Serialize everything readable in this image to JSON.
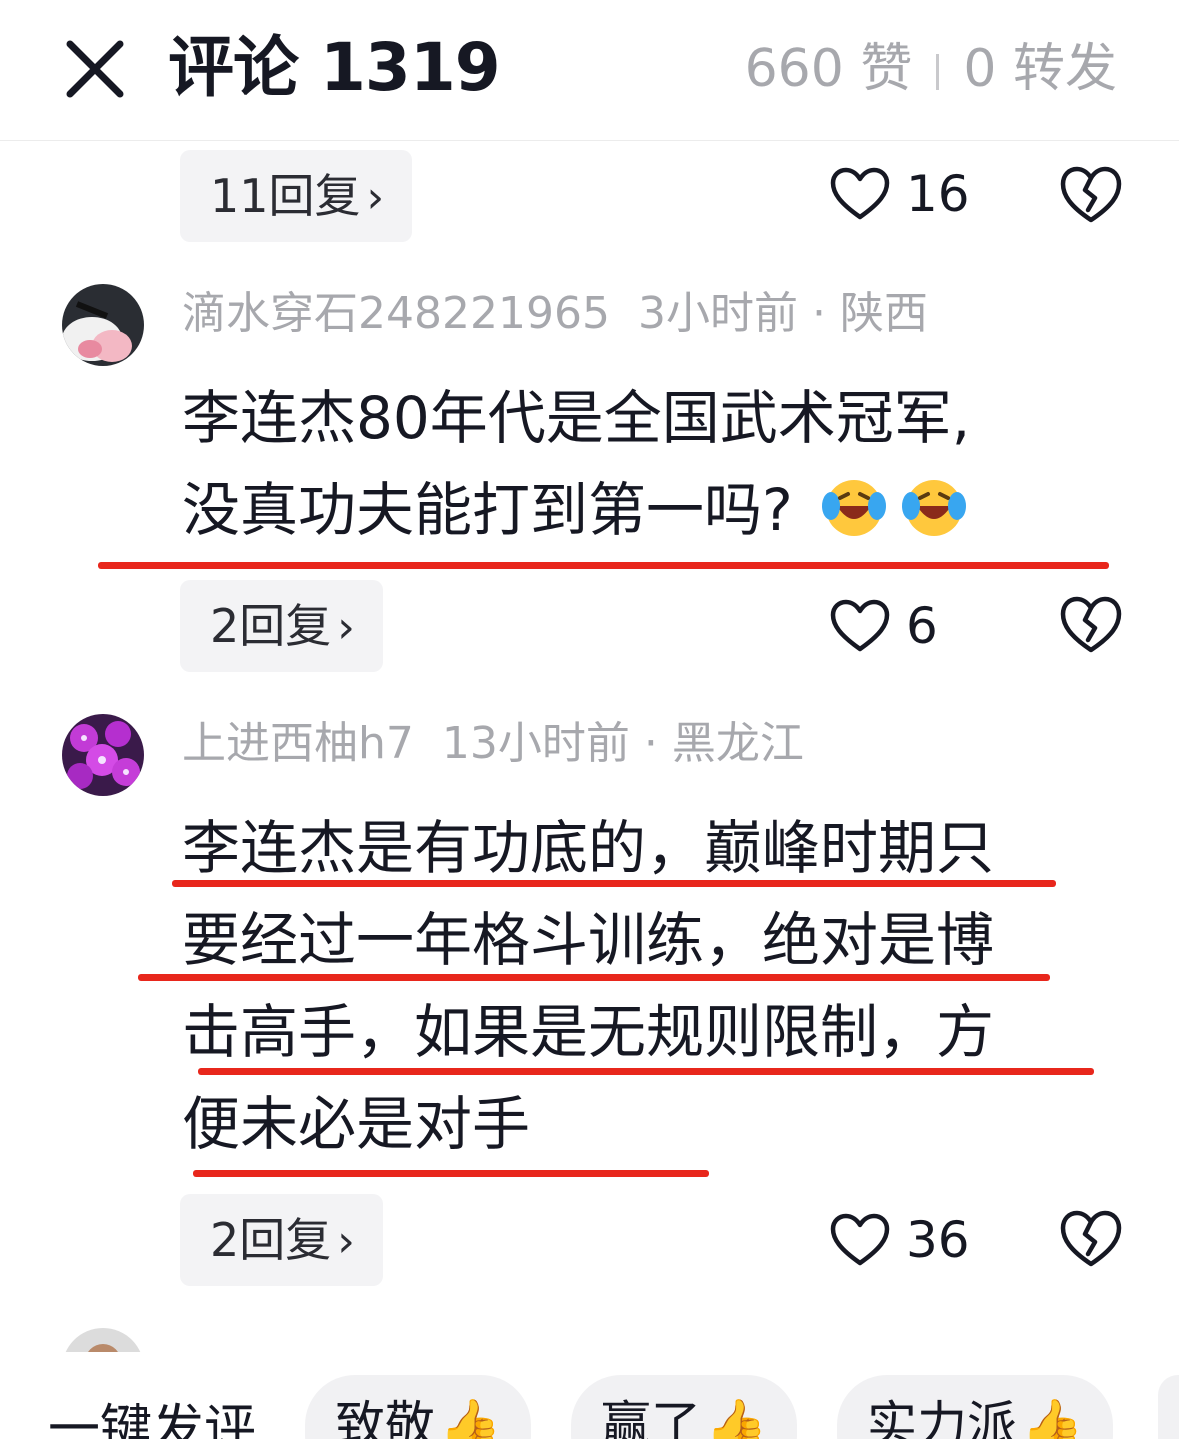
{
  "header": {
    "title": "评论 1319",
    "likes": "660 赞",
    "shares": "0 转发"
  },
  "top_reply": {
    "label": "11回复",
    "likes": "16"
  },
  "comments": [
    {
      "user": "滴水穿石248221965",
      "time": "3小时前",
      "dot": "·",
      "region": "陕西",
      "lines": [
        "李连杰80年代是全国武术冠军,",
        "没真功夫能打到第一吗?"
      ],
      "reply_label": "2回复",
      "likes": "6"
    },
    {
      "user": "上进西柚h7",
      "time": "13小时前",
      "dot": "·",
      "region": "黑龙江",
      "lines": [
        "李连杰是有功底的，巅峰时期只",
        "要经过一年格斗训练，绝对是博",
        "击高手，如果是无规则限制，方",
        "便未必是对手"
      ],
      "reply_label": "2回复",
      "likes": "36"
    }
  ],
  "quick": {
    "label": "一键发评",
    "chips": [
      "致敬",
      "赢了",
      "实力派"
    ]
  },
  "icons": {
    "close": "close-icon",
    "like": "heart-outline-icon",
    "dislike": "broken-heart-icon",
    "chevron": "chevron-right-icon",
    "emoji": "laugh-cry-emoji-icon",
    "thumb": "thumbs-up-icon"
  },
  "colors": {
    "accent_underline": "#e8271c",
    "muted": "#a7a8ad"
  }
}
